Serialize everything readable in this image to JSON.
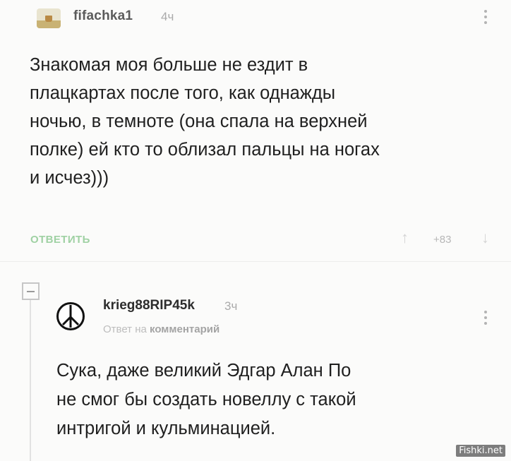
{
  "comment": {
    "username": "fifachka1",
    "time": "4ч",
    "text": "Знакомая моя больше не ездит в\nплацкартах после того, как однажды\nночью, в темноте (она спала на верхней\nполке) ей кто то облизал пальцы на ногах\nи исчез)))",
    "reply_label": "ОТВЕТИТЬ",
    "rating": "+83",
    "vote_up_glyph": "↑",
    "vote_down_glyph": "↓"
  },
  "reply": {
    "username": "krieg88RIP45k",
    "time": "3ч",
    "reply_to_prefix": "Ответ на",
    "reply_to_link": "комментарий",
    "text": "Сука, даже великий Эдгар Алан По\nне смог бы создать новеллу с такой\nинтригой и кульминацией.",
    "collapse_icon": "minus-icon",
    "avatar_icon": "peace-sign-icon"
  },
  "watermark": "Fishki.net",
  "colors": {
    "reply_action": "#9fd1a3",
    "background": "#fbfbfa"
  }
}
